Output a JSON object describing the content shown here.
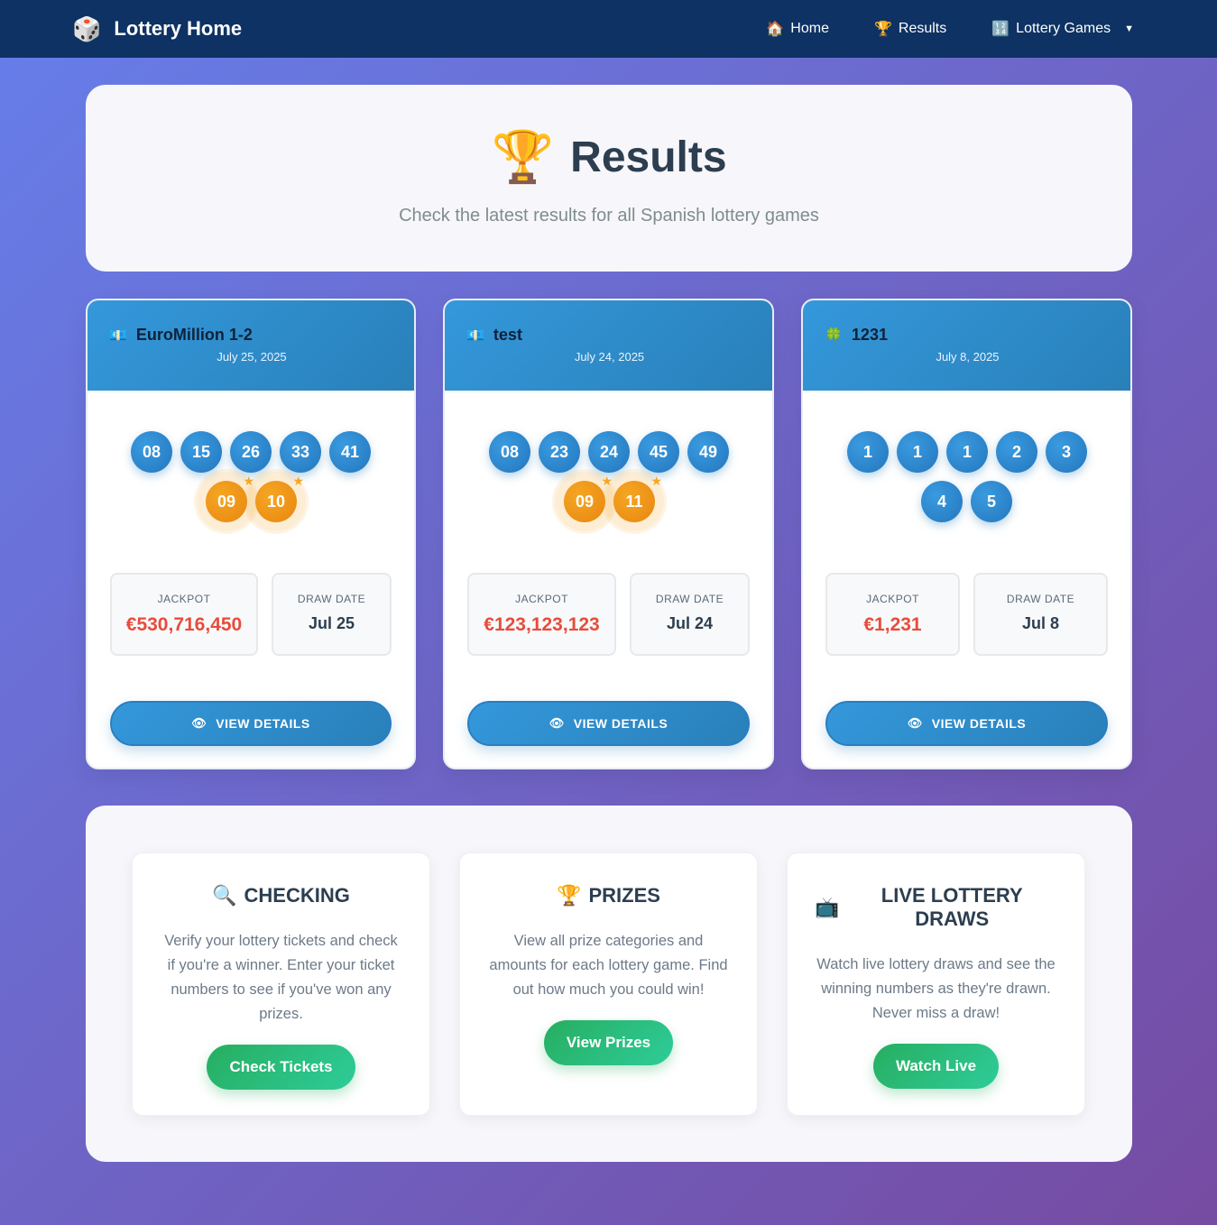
{
  "nav": {
    "brand": "Lottery Home",
    "brand_icon": "dice-icon",
    "links": [
      {
        "label": "Home",
        "icon": "🏠"
      },
      {
        "label": "Results",
        "icon": "🏆"
      },
      {
        "label": "Lottery Games",
        "icon": "🔢"
      }
    ],
    "dropdown_caret": "▼"
  },
  "hero": {
    "title": "Results",
    "subtitle": "Check the latest results for all Spanish lottery games"
  },
  "cards": [
    {
      "icon": "💶",
      "name": "EuroMillion 1-2",
      "date": "July 25, 2025",
      "numbers": [
        "08",
        "15",
        "26",
        "33",
        "41"
      ],
      "stars": [
        "09",
        "10"
      ],
      "jackpot_label": "JACKPOT",
      "jackpot": "€530,716,450",
      "draw_label": "DRAW DATE",
      "draw_date": "Jul 25",
      "button": "VIEW DETAILS"
    },
    {
      "icon": "💶",
      "name": "test",
      "date": "July 24, 2025",
      "numbers": [
        "08",
        "23",
        "24",
        "45",
        "49"
      ],
      "stars": [
        "09",
        "11"
      ],
      "jackpot_label": "JACKPOT",
      "jackpot": "€123,123,123",
      "draw_label": "DRAW DATE",
      "draw_date": "Jul 24",
      "button": "VIEW DETAILS"
    },
    {
      "icon": "🍀",
      "name": "1231",
      "date": "July 8, 2025",
      "numbers": [
        "1",
        "1",
        "1",
        "2",
        "3",
        "4",
        "5"
      ],
      "stars": [],
      "jackpot_label": "JACKPOT",
      "jackpot": "€1,231",
      "draw_label": "DRAW DATE",
      "draw_date": "Jul 8",
      "button": "VIEW DETAILS"
    }
  ],
  "features": [
    {
      "icon": "🔍",
      "title": "CHECKING",
      "description": "Verify your lottery tickets and check if you're a winner. Enter your ticket numbers to see if you've won any prizes.",
      "button": "Check Tickets"
    },
    {
      "icon": "🏆",
      "title": "PRIZES",
      "description": "View all prize categories and amounts for each lottery game. Find out how much you could win!",
      "button": "View Prizes"
    },
    {
      "icon": "📺",
      "title": "LIVE LOTTERY DRAWS",
      "description": "Watch live lottery draws and see the winning numbers as they're drawn. Never miss a draw!",
      "button": "Watch Live"
    }
  ]
}
